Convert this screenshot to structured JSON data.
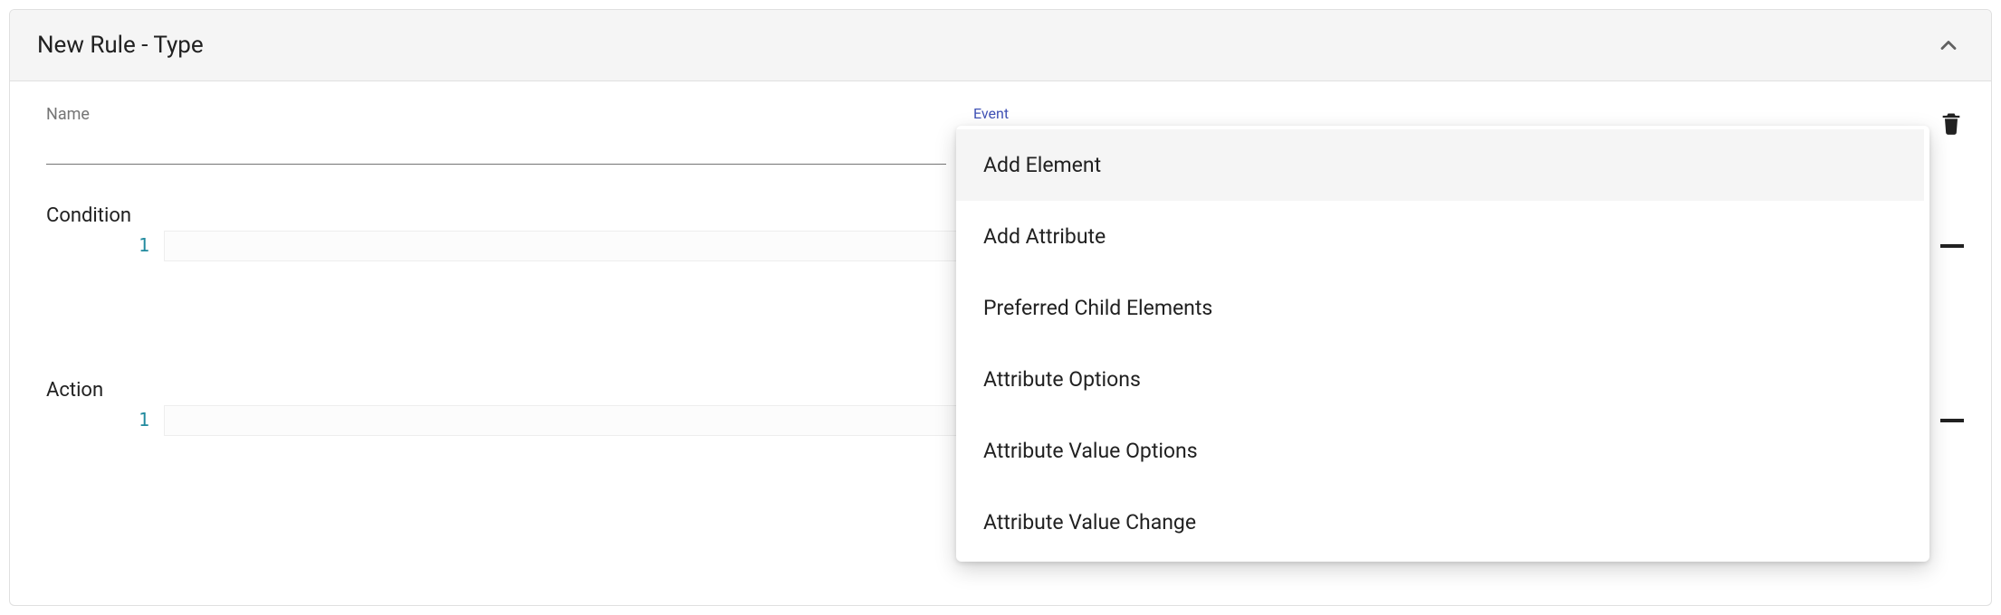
{
  "card": {
    "title": "New Rule - Type"
  },
  "fields": {
    "name": {
      "label": "Name",
      "value": ""
    },
    "event": {
      "label": "Event",
      "value": ""
    }
  },
  "sections": {
    "condition": {
      "label": "Condition",
      "line_number": "1",
      "value": ""
    },
    "action": {
      "label": "Action",
      "line_number": "1",
      "value": ""
    }
  },
  "dropdown": {
    "items": [
      "Add Element",
      "Add Attribute",
      "Preferred Child Elements",
      "Attribute Options",
      "Attribute Value Options",
      "Attribute Value Change"
    ],
    "highlighted_index": 0
  }
}
